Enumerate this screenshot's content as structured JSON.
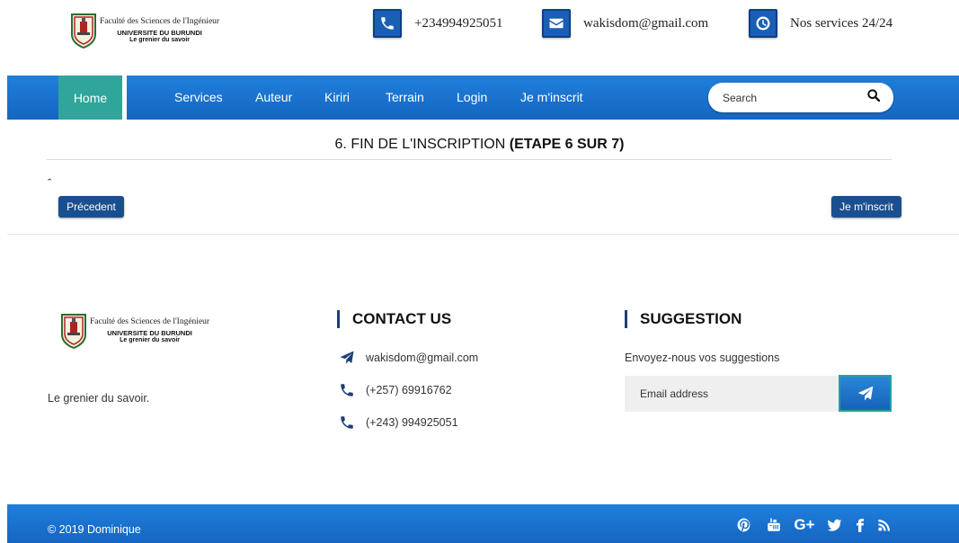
{
  "logo": {
    "line1": "Faculté des Sciences de l'Ingénieur",
    "line2": "UNIVERSITE DU BURUNDI",
    "line3": "Le grenier du savoir"
  },
  "topbar": {
    "phone": "+234994925051",
    "email": "wakisdom@gmail.com",
    "hours": "Nos services 24/24"
  },
  "nav": {
    "items": [
      "Home",
      "Services",
      "Auteur",
      "Kiriri",
      "Terrain",
      "Login",
      "Je m'inscrit"
    ],
    "active": "Home",
    "search_placeholder": "Search"
  },
  "step": {
    "title_prefix": "6. FIN DE L'INSCRIPTION ",
    "title_bold": "(ETAPE 6 SUR 7)",
    "caret": "ˆ",
    "prev_label": "Précedent",
    "next_label": "Je m'inscrit"
  },
  "footer": {
    "tagline": "Le grenier du savoir.",
    "contact_heading": "CONTACT US",
    "contact_email": "wakisdom@gmail.com",
    "contact_phone1": "(+257) 69916762",
    "contact_phone2": "(+243) 994925051",
    "suggestion_heading": "SUGGESTION",
    "suggestion_text": "Envoyez-nous vos suggestions",
    "email_placeholder": "Email address",
    "copyright": "© 2019 Dominique",
    "social_icons": [
      "pinterest-icon",
      "youtube-icon",
      "google-plus-icon",
      "twitter-icon",
      "facebook-icon",
      "rss-icon"
    ]
  },
  "colors": {
    "nav_blue": "#1a73d0",
    "active_teal": "#2fa59c",
    "button_navy": "#1a4f8f"
  }
}
